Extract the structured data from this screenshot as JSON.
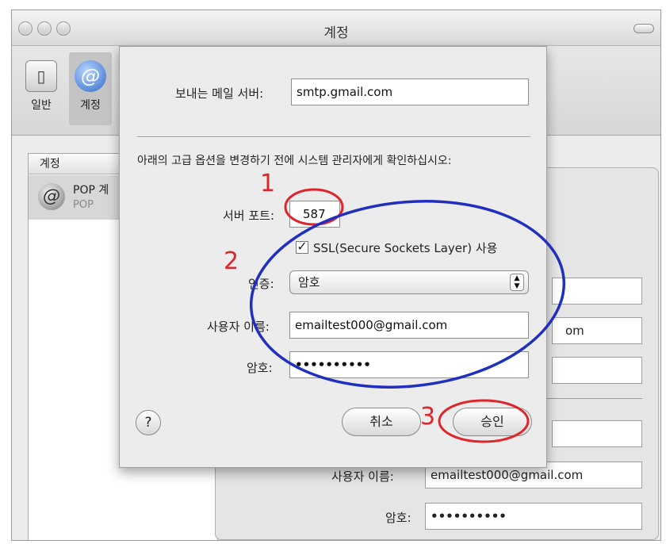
{
  "window": {
    "title": "계정"
  },
  "toolbar": {
    "items": [
      {
        "label": "일반",
        "icon": "switch-icon"
      },
      {
        "label": "계정",
        "icon": "at-icon"
      }
    ]
  },
  "account_list": {
    "header": "계정",
    "items": [
      {
        "name": "POP 계",
        "type": "POP"
      }
    ]
  },
  "background_panel": {
    "username_label": "사용자 이름:",
    "username_value": "emailtest000@gmail.com",
    "password_label": "암호:",
    "password_value": "••••••••••",
    "partial_text": "om"
  },
  "sheet": {
    "smtp_label": "보내는 메일 서버:",
    "smtp_value": "smtp.gmail.com",
    "note": "아래의 고급 옵션을 변경하기 전에 시스템 관리자에게 확인하십시오:",
    "port_label": "서버 포트:",
    "port_value": "587",
    "ssl_checked": true,
    "ssl_label": "SSL(Secure Sockets Layer) 사용",
    "auth_label": "인증:",
    "auth_value": "암호",
    "username_label": "사용자 이름:",
    "username_value": "emailtest000@gmail.com",
    "password_label": "암호:",
    "password_value": "••••••••••",
    "help_label": "?",
    "cancel_label": "취소",
    "ok_label": "승인"
  },
  "annotations": {
    "step1": "1",
    "step2": "2",
    "step3": "3",
    "color_red": "#e0242a",
    "color_blue": "#1f2fbf"
  }
}
